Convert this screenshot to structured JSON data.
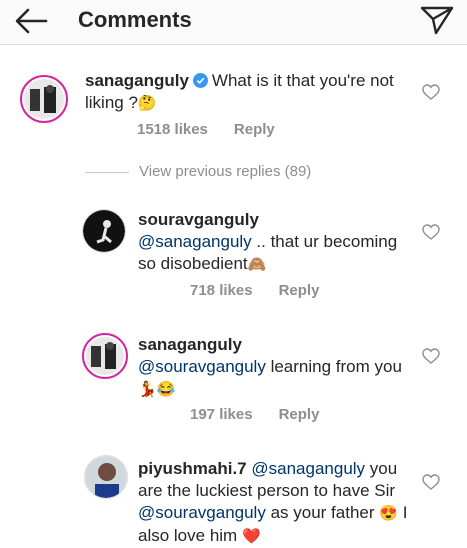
{
  "header": {
    "title": "Comments",
    "back_icon": "back-arrow-icon",
    "send_icon": "direct-send-icon"
  },
  "comments": [
    {
      "username": "sanaganguly",
      "verified": true,
      "text": "What is it that you're not liking ?",
      "emoji": "🤔",
      "likes": "1518 likes",
      "reply": "Reply"
    },
    {
      "username": "souravganguly",
      "mention": "@sanaganguly",
      "text": ".. that ur becoming so disobedient",
      "emoji": "🙈",
      "likes": "718 likes",
      "reply": "Reply"
    },
    {
      "username": "sanaganguly",
      "mention": "@souravganguly",
      "text": "learning from you",
      "emoji": "💃😂",
      "likes": "197 likes",
      "reply": "Reply"
    },
    {
      "username": "piyushmahi.7",
      "mention": "@sanaganguly",
      "text_1": "you are the luckiest person to have Sir",
      "mention_2": "@souravganguly",
      "text_2": "as your father",
      "emoji_1": "😍",
      "text_3": "I also love him",
      "emoji_2": "❤️"
    }
  ],
  "view_replies": "View previous replies (89)",
  "colors": {
    "accent_link": "#003569",
    "muted": "#8e8e8e",
    "verified": "#3897f0",
    "heart_red": "#ed4956"
  }
}
